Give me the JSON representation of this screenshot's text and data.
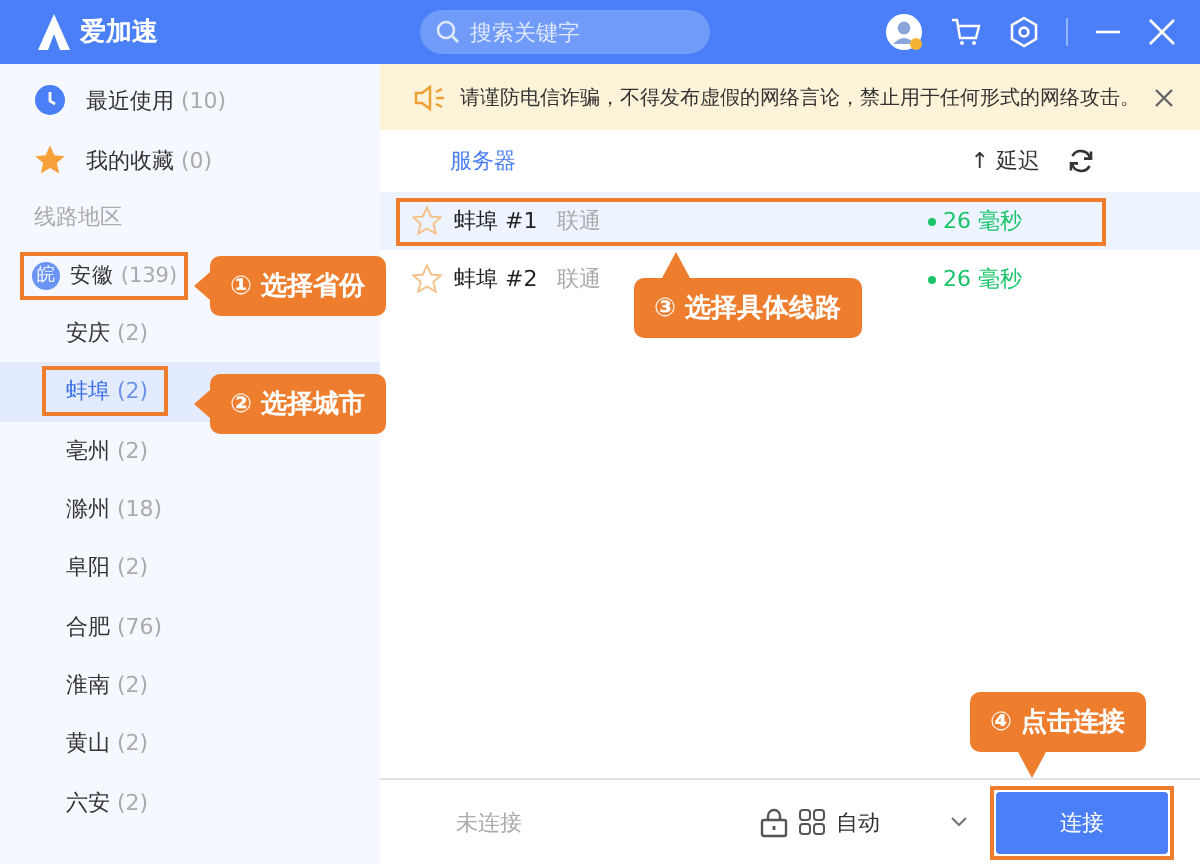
{
  "titlebar": {
    "app_name": "爱加速",
    "search": {
      "placeholder": "搜索关键字"
    }
  },
  "sidebar": {
    "shortcuts": [
      {
        "kind": "recent",
        "label": "最近使用",
        "count": "(10)"
      },
      {
        "kind": "favorites",
        "label": "我的收藏",
        "count": "(0)"
      }
    ],
    "section_label": "线路地区",
    "province": {
      "badge": "皖",
      "label": "安徽",
      "count": "(139)",
      "highlighted": true,
      "children": [
        {
          "label": "安庆",
          "count": "(2)",
          "selected": false,
          "highlighted": false
        },
        {
          "label": "蚌埠",
          "count": "(2)",
          "selected": true,
          "highlighted": true
        },
        {
          "label": "亳州",
          "count": "(2)",
          "selected": false,
          "highlighted": false
        },
        {
          "label": "滁州",
          "count": "(18)",
          "selected": false,
          "highlighted": false
        },
        {
          "label": "阜阳",
          "count": "(2)",
          "selected": false,
          "highlighted": false
        },
        {
          "label": "合肥",
          "count": "(76)",
          "selected": false,
          "highlighted": false
        },
        {
          "label": "淮南",
          "count": "(2)",
          "selected": false,
          "highlighted": false
        },
        {
          "label": "黄山",
          "count": "(2)",
          "selected": false,
          "highlighted": false
        },
        {
          "label": "六安",
          "count": "(2)",
          "selected": false,
          "highlighted": false
        }
      ]
    }
  },
  "notice": {
    "text": "请谨防电信诈骗，不得发布虚假的网络言论，禁止用于任何形式的网络攻击。"
  },
  "table": {
    "columns": [
      "服务器",
      "↑ 延迟"
    ],
    "rows": [
      {
        "name": "蚌埠 #1",
        "carrier": "联通",
        "latency": "26 毫秒",
        "favorite": false,
        "selected": true,
        "highlighted": true
      },
      {
        "name": "蚌埠 #2",
        "carrier": "联通",
        "latency": "26 毫秒",
        "favorite": false,
        "selected": false,
        "highlighted": false
      }
    ]
  },
  "footer": {
    "status": "未连接",
    "mode": "自动",
    "connect_button": "连接",
    "connect_highlighted": true
  },
  "callouts": [
    {
      "text": "① 选择省份"
    },
    {
      "text": "② 选择城市"
    },
    {
      "text": "③ 选择具体线路"
    },
    {
      "text": "④ 点击连接"
    }
  ]
}
